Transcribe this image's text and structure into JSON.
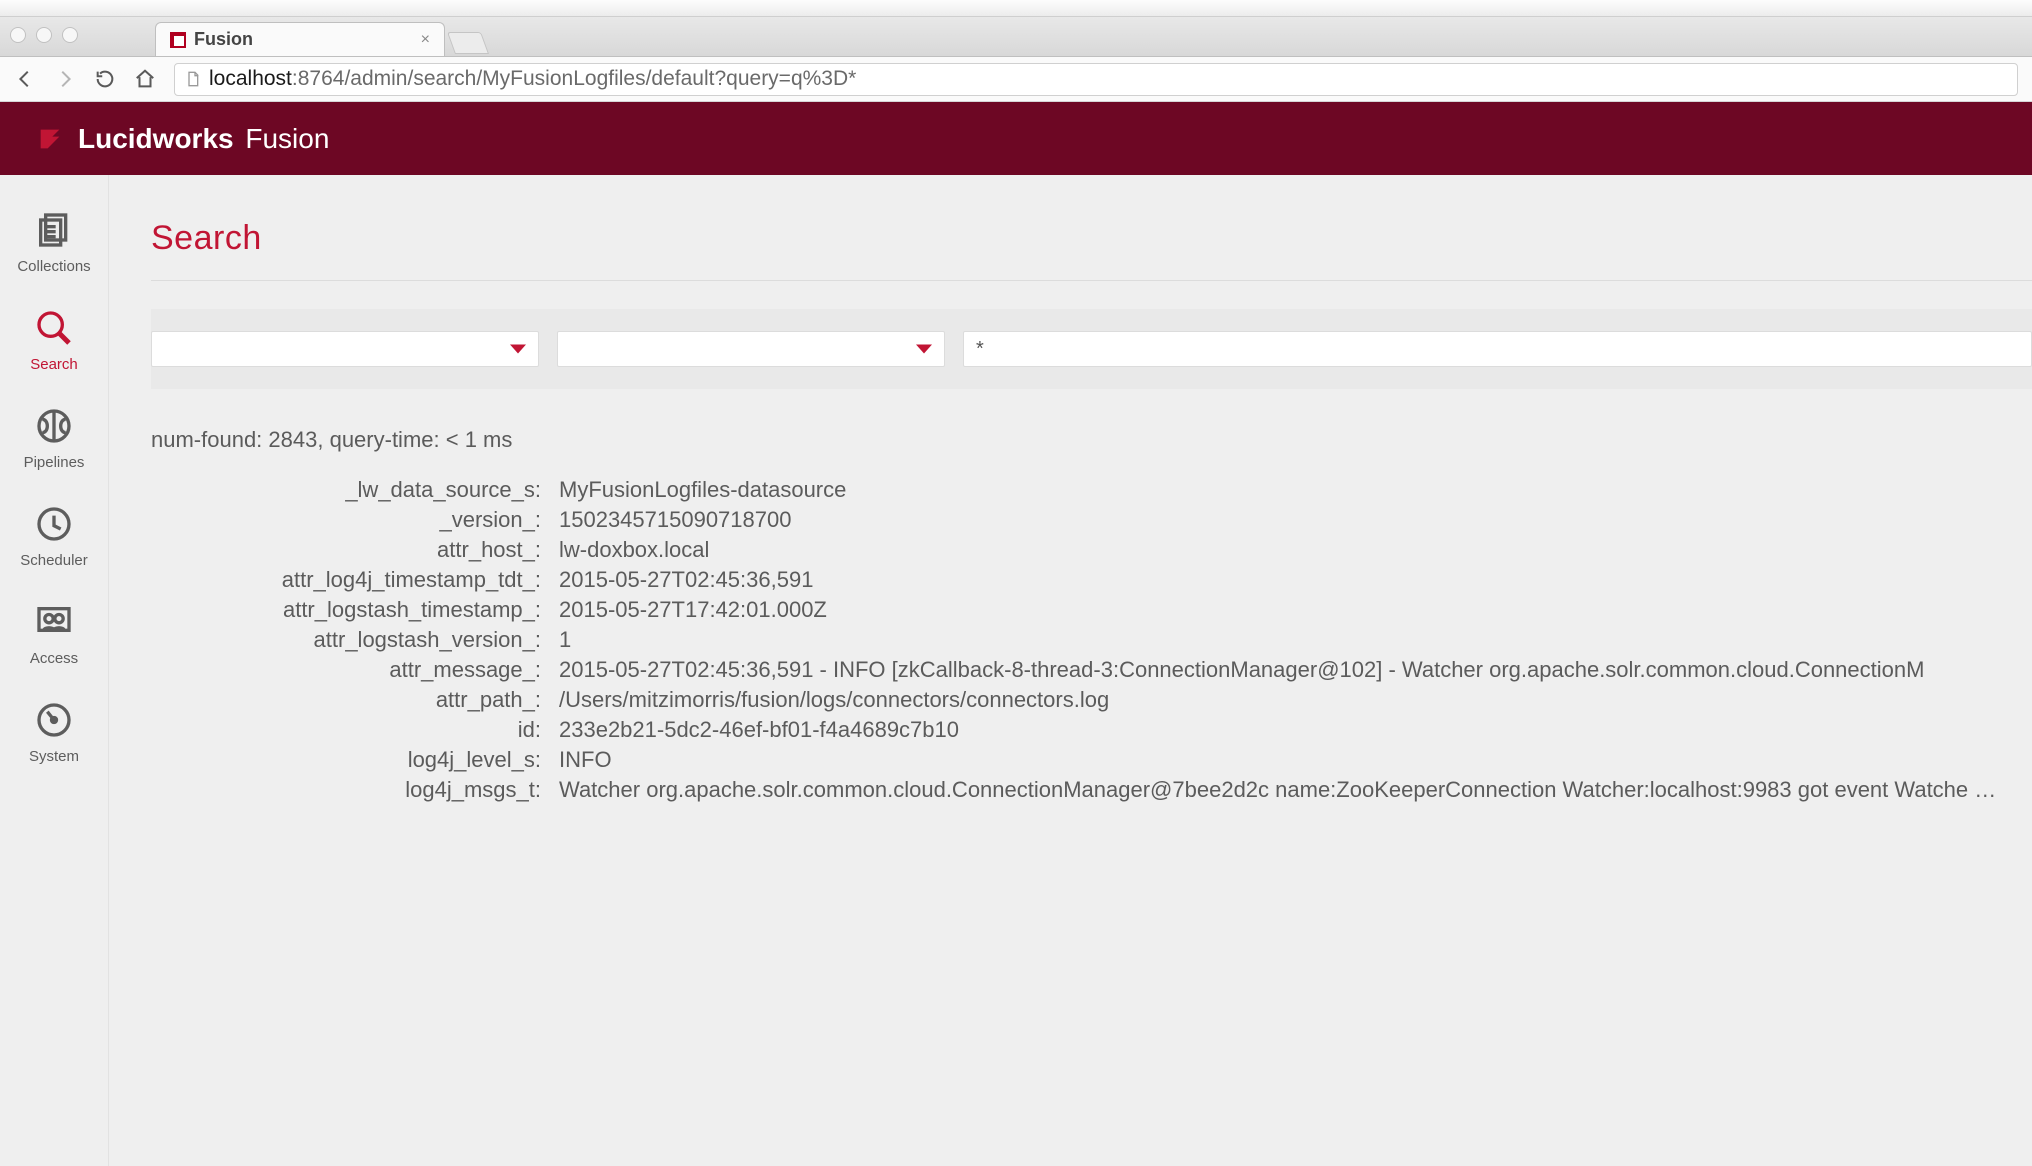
{
  "browser": {
    "tab_title": "Fusion",
    "url_host": "localhost",
    "url_port": ":8764",
    "url_path": "/admin/search/MyFusionLogfiles/default?query=q%3D*"
  },
  "brand": {
    "name1": "Lucidworks",
    "name2": "Fusion"
  },
  "sidebar": {
    "items": [
      {
        "id": "collections",
        "label": "Collections"
      },
      {
        "id": "search",
        "label": "Search"
      },
      {
        "id": "pipelines",
        "label": "Pipelines"
      },
      {
        "id": "scheduler",
        "label": "Scheduler"
      },
      {
        "id": "access",
        "label": "Access"
      },
      {
        "id": "system",
        "label": "System"
      }
    ]
  },
  "page": {
    "title": "Search"
  },
  "filters": {
    "dropdown1": "",
    "dropdown2": "",
    "query": "*"
  },
  "results": {
    "summary_prefix": "num-found: ",
    "num_found": "2843",
    "summary_mid": ", query-time: ",
    "query_time": "< 1 ms"
  },
  "doc": [
    {
      "k": "_lw_data_source_s:",
      "v": "MyFusionLogfiles-datasource"
    },
    {
      "k": "_version_:",
      "v": "1502345715090718700"
    },
    {
      "k": "attr_host_:",
      "v": "lw-doxbox.local"
    },
    {
      "k": "attr_log4j_timestamp_tdt_:",
      "v": "2015-05-27T02:45:36,591"
    },
    {
      "k": "attr_logstash_timestamp_:",
      "v": "2015-05-27T17:42:01.000Z"
    },
    {
      "k": "attr_logstash_version_:",
      "v": "1"
    },
    {
      "k": "attr_message_:",
      "v": "2015-05-27T02:45:36,591 - INFO [zkCallback-8-thread-3:ConnectionManager@102] - Watcher org.apache.solr.common.cloud.ConnectionM"
    },
    {
      "k": "attr_path_:",
      "v": "/Users/mitzimorris/fusion/logs/connectors/connectors.log"
    },
    {
      "k": "id:",
      "v": "233e2b21-5dc2-46ef-bf01-f4a4689c7b10"
    },
    {
      "k": "log4j_level_s:",
      "v": "INFO"
    },
    {
      "k": "log4j_msgs_t:",
      "v": "Watcher org.apache.solr.common.cloud.ConnectionManager@7bee2d2c name:ZooKeeperConnection Watcher:localhost:9983 got event Watche …"
    }
  ]
}
